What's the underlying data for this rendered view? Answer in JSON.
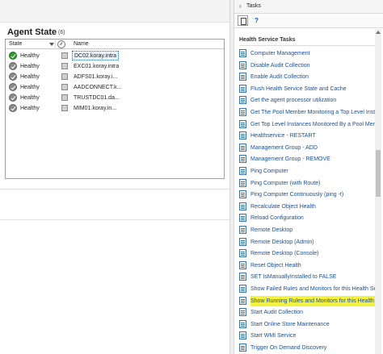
{
  "agent_state": {
    "title": "Agent State",
    "count": "(6)",
    "columns": {
      "state": "State",
      "name": "Name"
    },
    "rows": [
      {
        "state": "Healthy",
        "name": "DC02.koray.intra",
        "status": "green",
        "selected": true
      },
      {
        "state": "Healthy",
        "name": "EXC01.koray.intra",
        "status": "gray",
        "selected": false
      },
      {
        "state": "Healthy",
        "name": "ADFS01.koray.i...",
        "status": "gray",
        "selected": false
      },
      {
        "state": "Healthy",
        "name": "AADCONNECT.k...",
        "status": "gray",
        "selected": false
      },
      {
        "state": "Healthy",
        "name": "TRUSTDC01.da...",
        "status": "gray",
        "selected": false
      },
      {
        "state": "Healthy",
        "name": "MIM01.koray.in...",
        "status": "gray",
        "selected": false
      }
    ]
  },
  "tasks_pane": {
    "title": "Tasks",
    "help_glyph": "?",
    "section_title": "Health Service Tasks",
    "items": [
      "Computer Management",
      "Disable Audit Collection",
      "Enable Audit Collection",
      "Flush Health Service State and Cache",
      "Get the agent processor utilization",
      "Get The Pool Member Monitoring a Top Level Instance",
      "Get Top Level Instances Monitored By a Pool Member",
      "Healthservice - RESTART",
      "Management Group - ADD",
      "Management Group - REMOVE",
      "Ping Computer",
      "Ping Computer (with Route)",
      "Ping Computer Continuously (ping -t)",
      "Recalculate Object Health",
      "Reload Configuration",
      "Remote Desktop",
      "Remote Desktop (Admin)",
      "Remote Desktop (Console)",
      "Reset Object Health",
      "SET IsManuallyInstalled to FALSE",
      "Show Failed Rules and Monitors for this Health Service",
      "Show Running Rules and Monitors for this Health Servi",
      "Start Audit Collection",
      "Start Online Store Maintenance",
      "Start WMI Service",
      "Trigger On Demand Discovery"
    ],
    "highlighted_index": 21
  },
  "colors": {
    "link": "#1a4f9c",
    "highlight": "#f4f23a",
    "healthy_green": "#2e9a2e"
  }
}
